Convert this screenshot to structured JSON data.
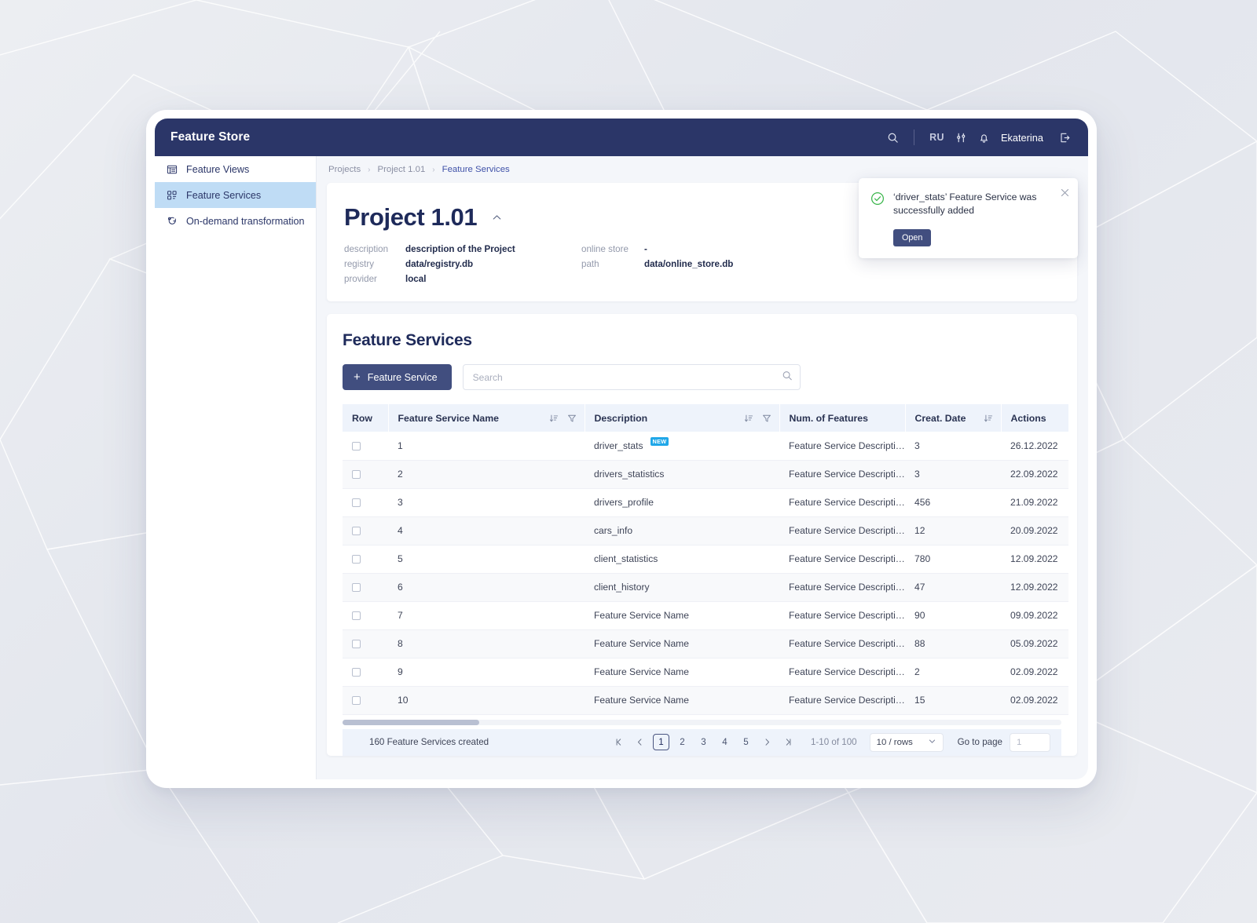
{
  "topbar": {
    "title": "Feature Store",
    "search_icon": "search-icon",
    "lang": "RU",
    "settings_icon": "sliders-icon",
    "bell_icon": "bell-icon",
    "username": "Ekaterina",
    "logout_icon": "logout-icon"
  },
  "sidebar": {
    "items": [
      {
        "label": "Feature Views",
        "icon": "list-view-icon",
        "active": false
      },
      {
        "label": "Feature Services",
        "icon": "grid-blocks-icon",
        "active": true
      },
      {
        "label": "On-demand transformation",
        "icon": "transform-icon",
        "active": false
      }
    ]
  },
  "breadcrumb": {
    "items": [
      {
        "label": "Projects",
        "current": false
      },
      {
        "label": "Project 1.01",
        "current": false
      },
      {
        "label": "Feature Services",
        "current": true
      }
    ],
    "separator": "›"
  },
  "project": {
    "title": "Project 1.01",
    "collapse_icon": "chevron-up-icon",
    "meta": [
      {
        "key": "description",
        "value": "description of the Project"
      },
      {
        "key": "online store",
        "value": "-"
      },
      {
        "key": "registry",
        "value": "data/registry.db"
      },
      {
        "key": "path",
        "value": "data/online_store.db"
      },
      {
        "key": "provider",
        "value": "local"
      }
    ]
  },
  "table_section": {
    "title": "Feature Services",
    "add_button": "Feature Service",
    "add_icon": "plus-icon",
    "search_placeholder": "Search",
    "search_value": "",
    "search_icon": "search-icon",
    "columns": [
      {
        "label": "Row",
        "sort": false,
        "filter": false
      },
      {
        "label": "Feature Service Name",
        "sort": true,
        "filter": true
      },
      {
        "label": "Description",
        "sort": true,
        "filter": true
      },
      {
        "label": "Num. of Features",
        "sort": false,
        "filter": false
      },
      {
        "label": "Creat. Date",
        "sort": true,
        "filter": false
      },
      {
        "label": "Actions",
        "sort": false,
        "filter": false
      }
    ],
    "rows": [
      {
        "row": "1",
        "name": "driver_stats",
        "badge": "NEW",
        "description": "Feature Service Description",
        "num": "3",
        "date": "26.12.2022"
      },
      {
        "row": "2",
        "name": "drivers_statistics",
        "badge": "",
        "description": "Feature Service Description",
        "num": "3",
        "date": "22.09.2022"
      },
      {
        "row": "3",
        "name": "drivers_profile",
        "badge": "",
        "description": "Feature Service Description",
        "num": "456",
        "date": "21.09.2022"
      },
      {
        "row": "4",
        "name": "cars_info",
        "badge": "",
        "description": "Feature Service Description",
        "num": "12",
        "date": "20.09.2022"
      },
      {
        "row": "5",
        "name": "client_statistics",
        "badge": "",
        "description": "Feature Service Description",
        "num": "780",
        "date": "12.09.2022"
      },
      {
        "row": "6",
        "name": "client_history",
        "badge": "",
        "description": "Feature Service Description",
        "num": "47",
        "date": "12.09.2022"
      },
      {
        "row": "7",
        "name": "Feature Service Name",
        "badge": "",
        "description": "Feature Service Description",
        "num": "90",
        "date": "09.09.2022"
      },
      {
        "row": "8",
        "name": "Feature Service Name",
        "badge": "",
        "description": "Feature Service Description",
        "num": "88",
        "date": "05.09.2022"
      },
      {
        "row": "9",
        "name": "Feature Service Name",
        "badge": "",
        "description": "Feature Service Description",
        "num": "2",
        "date": "02.09.2022"
      },
      {
        "row": "10",
        "name": "Feature Service Name",
        "badge": "",
        "description": "Feature Service Description",
        "num": "15",
        "date": "02.09.2022"
      }
    ],
    "row_action_icons": [
      "chart-bar-icon",
      "edit-pencil-icon",
      "trash-icon"
    ]
  },
  "footer": {
    "summary": "160 Feature Services created",
    "first_icon": "first-page-icon",
    "prev_icon": "prev-page-icon",
    "pages": [
      "1",
      "2",
      "3",
      "4",
      "5"
    ],
    "current_page": "1",
    "next_icon": "next-page-icon",
    "last_icon": "last-page-icon",
    "range": "1-10 of 100",
    "rows_per_page": "10 / rows",
    "rows_chevron": "chevron-down-icon",
    "goto_label": "Go to page",
    "goto_placeholder": "1",
    "goto_value": ""
  },
  "toast": {
    "icon": "success-check-icon",
    "message": "‘driver_stats’ Feature Service was successfully added",
    "action": "Open",
    "close_icon": "close-icon"
  },
  "colors": {
    "brand_navy": "#2b3668",
    "accent_blue": "#bfdcf5",
    "button_navy": "#414e7f",
    "badge_blue": "#20a7e8",
    "success_green": "#39b54a",
    "header_row": "#eef3fb"
  }
}
